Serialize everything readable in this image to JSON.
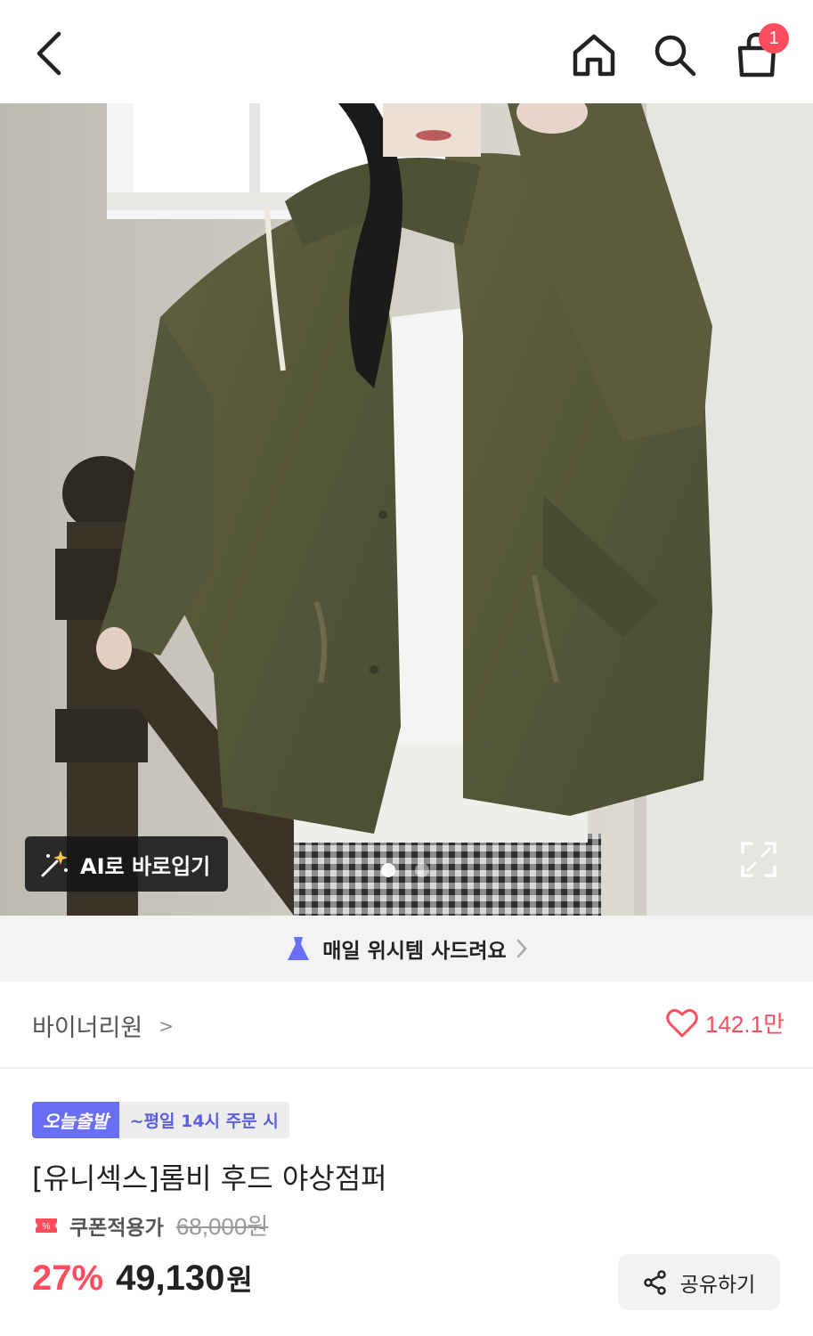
{
  "header": {
    "back_icon": "chevron-left-icon",
    "home_icon": "home-icon",
    "search_icon": "search-icon",
    "cart_icon": "shopping-bag-icon",
    "cart_count": "1"
  },
  "hero": {
    "ai_button_label": "AI로 바로입기",
    "carousel_total": 2,
    "carousel_active": 1
  },
  "promo": {
    "text": "매일 위시템 사드려요"
  },
  "brand": {
    "name": "바이너리원",
    "chevron": ">",
    "like_count": "142.1만"
  },
  "product": {
    "badge_today": "오늘출발",
    "badge_time": "~평일 14시 주문 시",
    "title": "[유니섹스]롬비 후드 야상점퍼",
    "coupon_label": "쿠폰적용가",
    "original_price": "68,000원",
    "discount": "27%",
    "price": "49,130",
    "currency": "원",
    "share_label": "공유하기"
  },
  "colors": {
    "accent_red": "#ff4d5e",
    "accent_purple": "#6a6ef5",
    "jacket_olive": "#5b5c3f"
  }
}
